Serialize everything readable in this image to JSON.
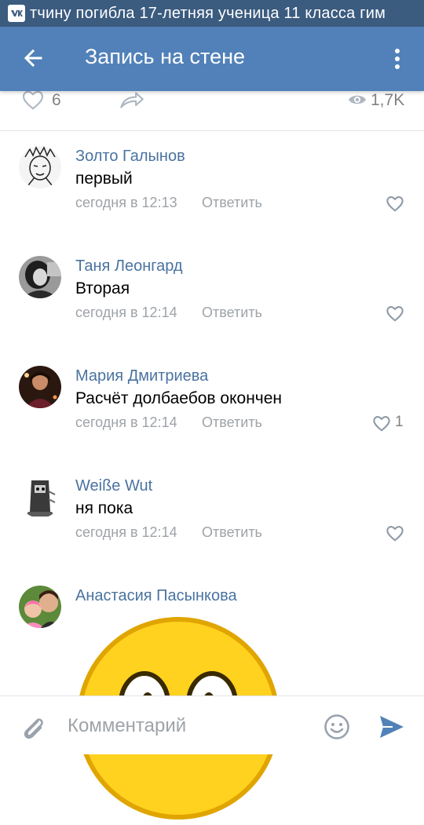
{
  "status_bar": {
    "app_icon": "vk-icon",
    "ticker_text": "тчину погибла 17-летняя ученица 11 класса гим"
  },
  "app_bar": {
    "title": "Запись на стене",
    "back_icon": "arrow-left-icon",
    "menu_icon": "more-vertical-icon"
  },
  "post_stats": {
    "likes": "6",
    "views": "1,7K"
  },
  "comments": [
    {
      "author": "Золто Галынов",
      "text": "первый",
      "time": "сегодня в 12:13",
      "reply_label": "Ответить",
      "likes": ""
    },
    {
      "author": "Таня Леонгард",
      "text": "Вторая",
      "time": "сегодня в 12:14",
      "reply_label": "Ответить",
      "likes": ""
    },
    {
      "author": "Мария Дмитриева",
      "text": "Расчёт долбаебов окончен",
      "time": "сегодня в 12:14",
      "reply_label": "Ответить",
      "likes": "1"
    },
    {
      "author": "Weiße Wut",
      "text": "ня пока",
      "time": "сегодня в 12:14",
      "reply_label": "Ответить",
      "likes": ""
    },
    {
      "author": "Анастасия Пасынкова",
      "sticker": "smiley-face-sticker"
    }
  ],
  "composer": {
    "placeholder": "Комментарий",
    "value": ""
  },
  "colors": {
    "status_bar": "#3b5b7f",
    "app_bar": "#5181b8",
    "author_name": "#4a73a0",
    "meta_text": "#9ea3a8",
    "send_icon": "#5181b8",
    "sticker_yellow": "#ffd21f"
  }
}
